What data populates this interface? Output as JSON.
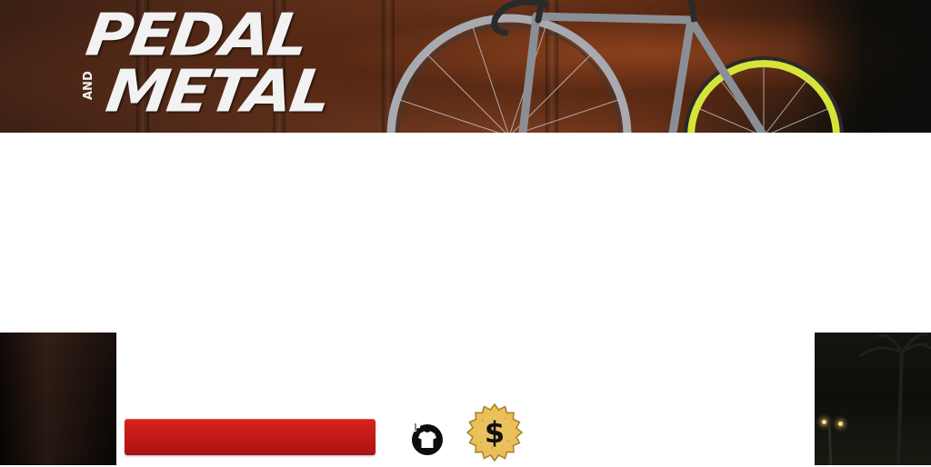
{
  "banner": {
    "logo_line1": "PEDAL",
    "logo_and": "AND",
    "logo_line2": "METAL",
    "bike_frame_color": "#8a8f96",
    "front_rim_color": "#d6e43a",
    "rear_rim_color": "#a7abb1"
  },
  "actions": {
    "primary_bar_label": "",
    "primary_bar_color": "#c41a16",
    "shirt_icon": "add-shirt-icon",
    "coin_icon": "dollar-coin-icon",
    "coin_symbol": "$",
    "coin_color": "#e9bf56"
  }
}
